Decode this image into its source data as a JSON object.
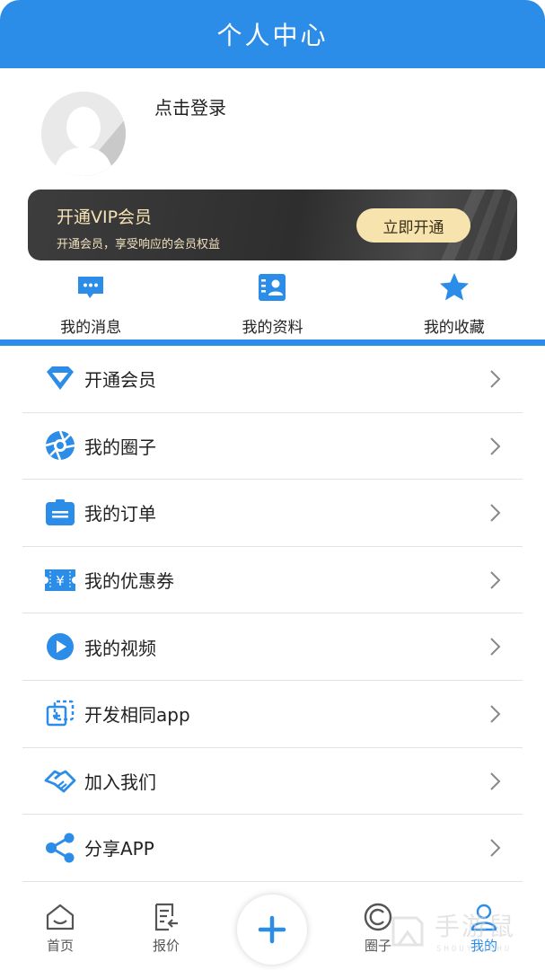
{
  "header": {
    "title": "个人中心"
  },
  "profile": {
    "login_text": "点击登录",
    "avatar_icon": "default-avatar-icon"
  },
  "vip": {
    "title": "开通VIP会员",
    "subtitle": "开通会员，享受响应的会员权益",
    "button": "立即开通",
    "colors": {
      "background": "#333333",
      "text": "#f6e3b6",
      "button": "#f6e3ad"
    }
  },
  "quick_links": [
    {
      "label": "我的消息",
      "icon": "message-icon"
    },
    {
      "label": "我的资料",
      "icon": "profile-card-icon"
    },
    {
      "label": "我的收藏",
      "icon": "star-icon"
    }
  ],
  "menu": [
    {
      "label": "开通会员",
      "icon": "diamond-icon"
    },
    {
      "label": "我的圈子",
      "icon": "aperture-icon"
    },
    {
      "label": "我的订单",
      "icon": "order-icon"
    },
    {
      "label": "我的优惠券",
      "icon": "coupon-icon"
    },
    {
      "label": "我的视频",
      "icon": "video-play-icon"
    },
    {
      "label": "开发相同app",
      "icon": "copy-app-icon"
    },
    {
      "label": "加入我们",
      "icon": "handshake-icon"
    },
    {
      "label": "分享APP",
      "icon": "share-icon"
    }
  ],
  "tabbar": {
    "items": [
      {
        "label": "首页",
        "icon": "home-icon"
      },
      {
        "label": "报价",
        "icon": "quote-icon"
      },
      {
        "label": "圈子",
        "icon": "circle-icon"
      },
      {
        "label": "我的",
        "icon": "user-icon",
        "active": true
      }
    ],
    "center_button_icon": "plus-icon"
  },
  "watermark": {
    "text": "手游鼠",
    "sub": "SHOUYOUSHU"
  },
  "colors": {
    "accent": "#2b8de8",
    "divider": "#e2e2e2"
  }
}
